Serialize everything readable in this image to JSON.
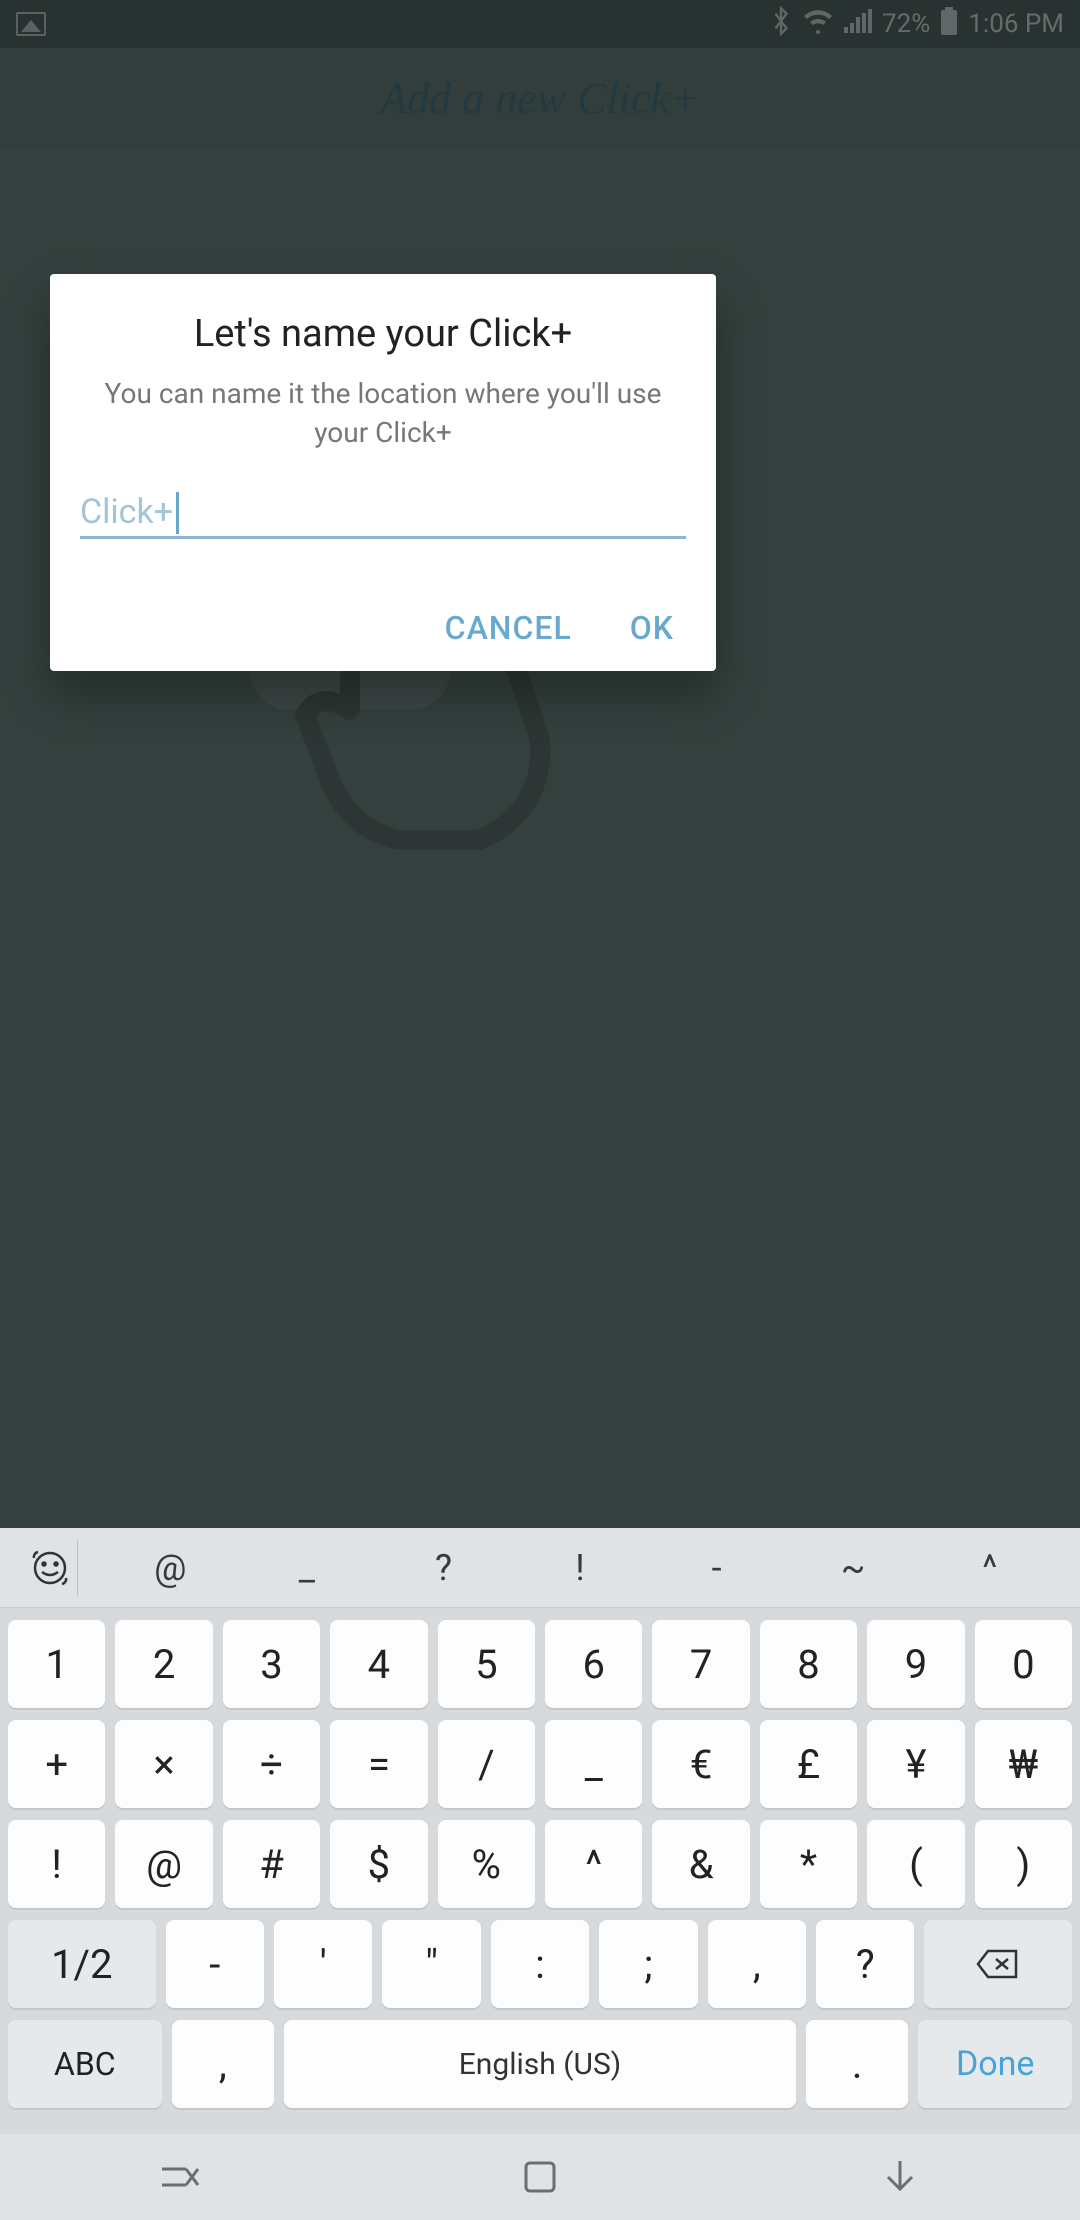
{
  "status": {
    "battery": "72%",
    "time": "1:06 PM"
  },
  "header": {
    "title": "Add a new  Click+"
  },
  "dialog": {
    "title": "Let's name your Click+",
    "subtitle": "You can name it the location where you'll use your Click+",
    "placeholder": "Click+",
    "value": "",
    "cancel": "CANCEL",
    "ok": "OK"
  },
  "suggestions": [
    "@",
    "_",
    "?",
    "!",
    "-",
    "~",
    "^"
  ],
  "keyboard": {
    "row1": [
      "1",
      "2",
      "3",
      "4",
      "5",
      "6",
      "7",
      "8",
      "9",
      "0"
    ],
    "row2": [
      "+",
      "×",
      "÷",
      "=",
      "/",
      "_",
      "€",
      "£",
      "¥",
      "₩"
    ],
    "row3": [
      "!",
      "@",
      "#",
      "$",
      "%",
      "^",
      "&",
      "*",
      "(",
      ")"
    ],
    "row4_page": "1/2",
    "row4": [
      "-",
      "'",
      "\"",
      ":",
      ";",
      ",",
      "?"
    ],
    "abc": "ABC",
    "comma": ",",
    "space": "English (US)",
    "period": ".",
    "done": "Done"
  }
}
